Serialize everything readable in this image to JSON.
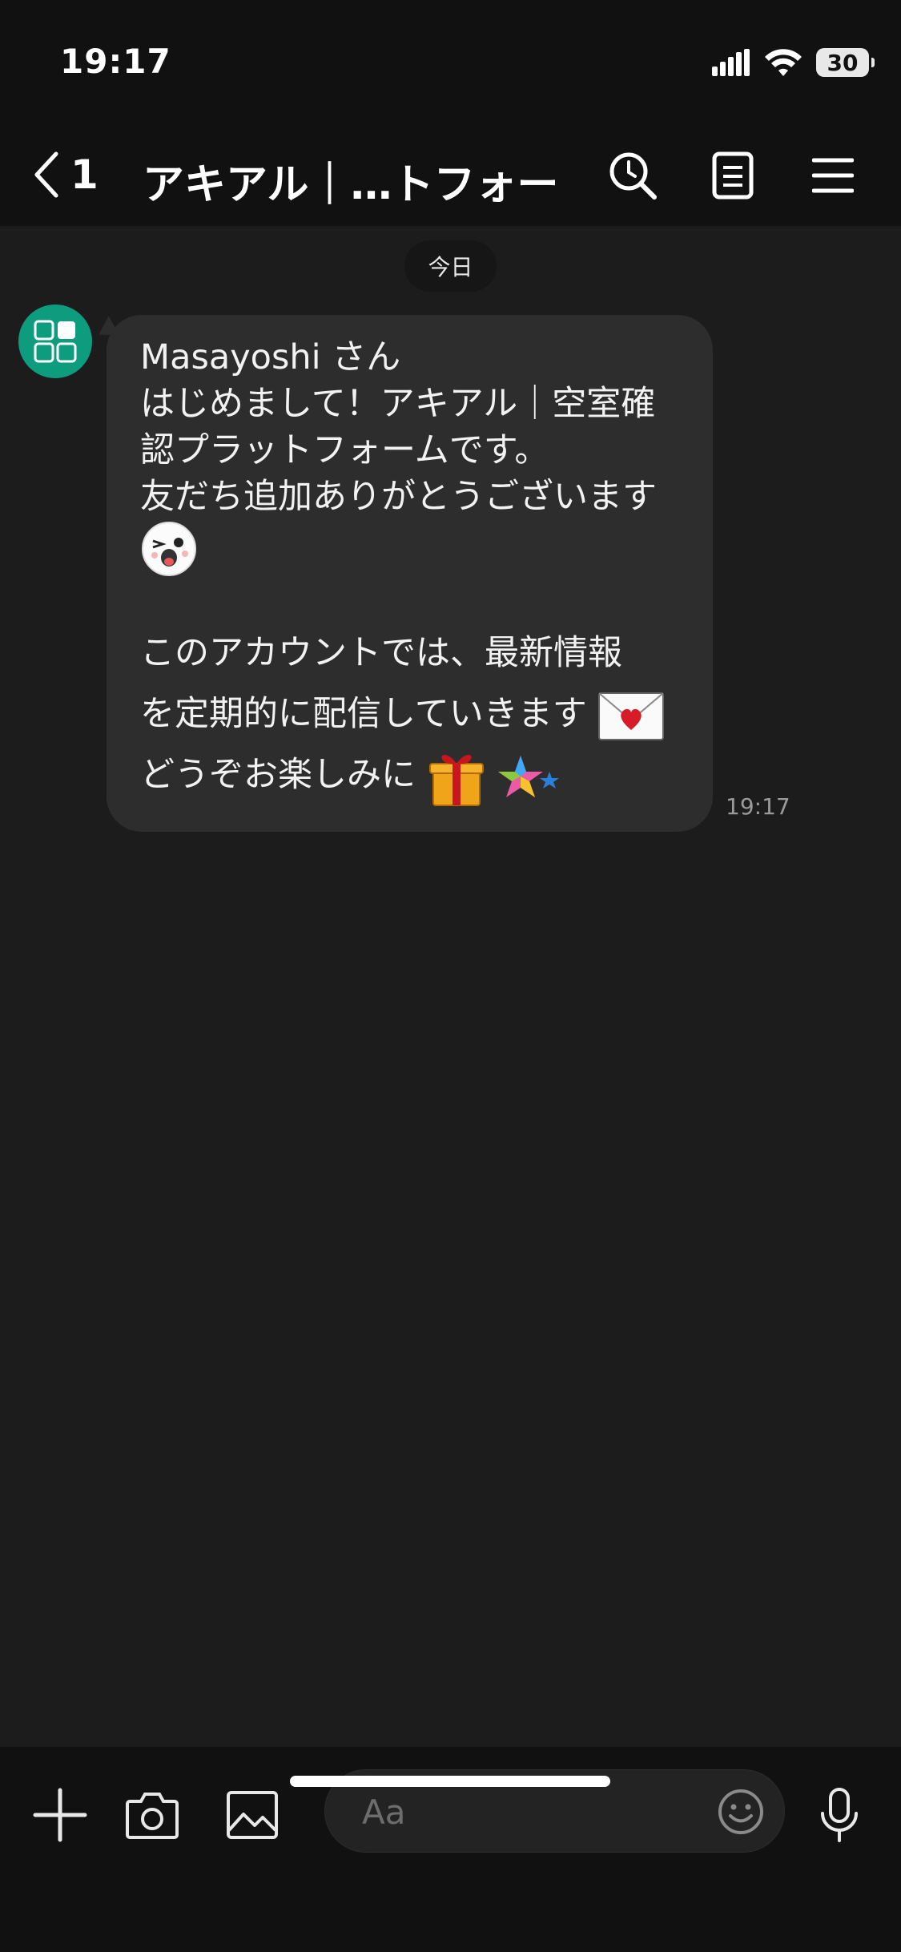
{
  "status_bar": {
    "time": "19:17",
    "battery": "30"
  },
  "header": {
    "back_count": "1",
    "title": "アキアル｜…トフォーム"
  },
  "chat": {
    "date_label": "今日",
    "message": {
      "lines": [
        "Masayoshi さん",
        "はじめまして！アキアル｜空室確",
        "認プラットフォームです。",
        "友だち追加ありがとうございます",
        "このアカウントでは、最新情報",
        "を定期的に配信していきます",
        "どうぞお楽しみに"
      ],
      "time": "19:17"
    }
  },
  "composer": {
    "placeholder": "Aa"
  }
}
